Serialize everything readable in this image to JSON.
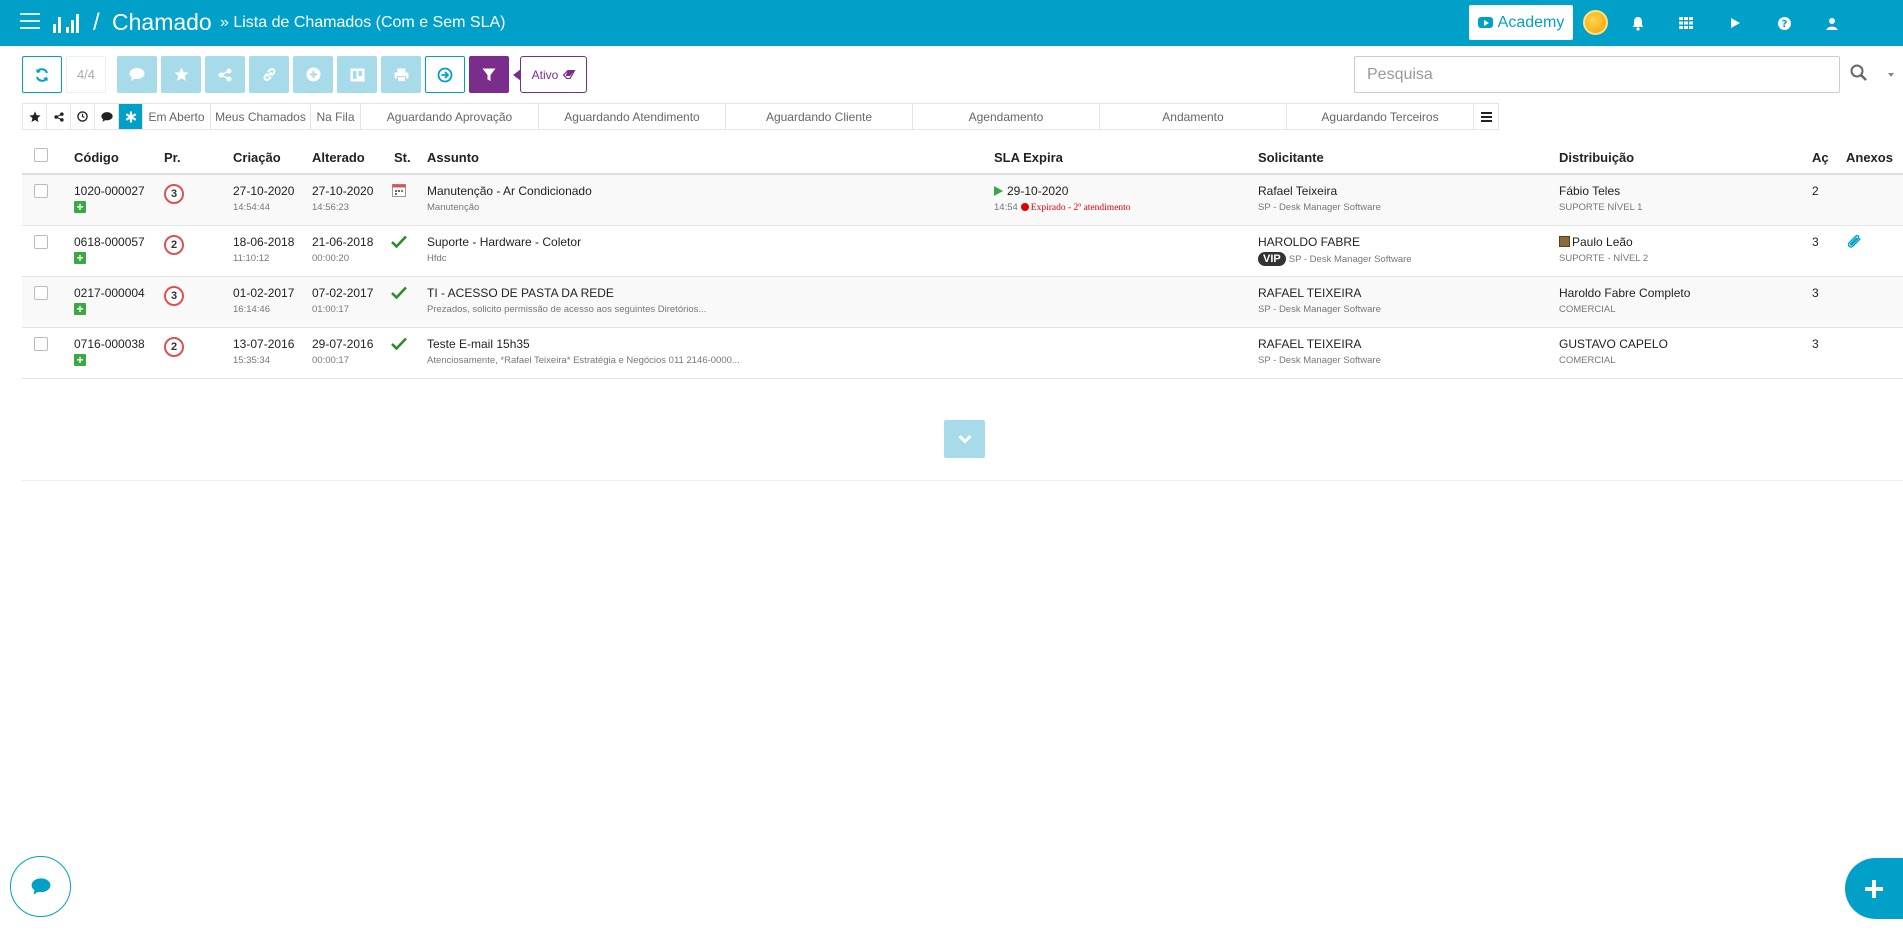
{
  "header": {
    "separator": "/",
    "module": "Chamado",
    "page_title": "» Lista de Chamados (Com e Sem SLA)",
    "academy_label": "Academy"
  },
  "colors": {
    "primary": "#00a0c8",
    "accent_purple": "#7b2d8b",
    "success": "#3aa845",
    "danger": "#e00000"
  },
  "toolbar": {
    "count": "4/4",
    "filter_status": "Ativo",
    "search_placeholder": "Pesquisa"
  },
  "tabs": [
    "Em Aberto",
    "Meus Chamados",
    "Na Fila",
    "Aguardando Aprovação",
    "Aguardando Atendimento",
    "Aguardando Cliente",
    "Agendamento",
    "Andamento",
    "Aguardando Terceiros"
  ],
  "table": {
    "columns": {
      "codigo": "Código",
      "prioridade": "Pr.",
      "criacao": "Criação",
      "alterado": "Alterado",
      "status": "St.",
      "assunto": "Assunto",
      "sla": "SLA Expira",
      "solicitante": "Solicitante",
      "distribuicao": "Distribuição",
      "acoes": "Aç",
      "anexos": "Anexos"
    },
    "rows": [
      {
        "codigo": "1020-000027",
        "prioridade": "3",
        "criacao_data": "27-10-2020",
        "criacao_hora": "14:54:44",
        "alterado_data": "27-10-2020",
        "alterado_hora": "14:56:23",
        "status_icon": "calendar-icon",
        "assunto": "Manutenção - Ar Condicionado",
        "assunto_sub": "Manutenção",
        "sla_data": "29-10-2020",
        "sla_hora": "14:54",
        "sla_status": "Expirado - 2º atendimento",
        "solicitante": "Rafael Teixeira",
        "vip": "",
        "solicitante_sub": "SP - Desk Manager Software",
        "distribuicao": "Fábio Teles",
        "distribuicao_sub": "SUPORTE NÍVEL 1",
        "acoes": "2",
        "anexo": false
      },
      {
        "codigo": "0618-000057",
        "prioridade": "2",
        "criacao_data": "18-06-2018",
        "criacao_hora": "11:10:12",
        "alterado_data": "21-06-2018",
        "alterado_hora": "00:00:20",
        "status_icon": "check-icon",
        "assunto": "Suporte - Hardware - Coletor",
        "assunto_sub": "Hfdc",
        "sla_data": "",
        "sla_hora": "",
        "sla_status": "",
        "solicitante": "HAROLDO FABRE",
        "vip": "VIP",
        "solicitante_sub": "SP - Desk Manager Software",
        "distribuicao": "Paulo Leão",
        "distribuicao_sub": "SUPORTE - NÍVEL 2",
        "acoes": "3",
        "anexo": true
      },
      {
        "codigo": "0217-000004",
        "prioridade": "3",
        "criacao_data": "01-02-2017",
        "criacao_hora": "16:14:46",
        "alterado_data": "07-02-2017",
        "alterado_hora": "01:00:17",
        "status_icon": "check-icon",
        "assunto": "TI - ACESSO DE PASTA DA REDE",
        "assunto_sub": "Prezados, solicito permissão de acesso aos seguintes Diretórios...",
        "sla_data": "",
        "sla_hora": "",
        "sla_status": "",
        "solicitante": "RAFAEL TEIXEIRA",
        "vip": "",
        "solicitante_sub": "SP - Desk Manager Software",
        "distribuicao": "Haroldo Fabre Completo",
        "distribuicao_sub": "COMERCIAL",
        "acoes": "3",
        "anexo": false
      },
      {
        "codigo": "0716-000038",
        "prioridade": "2",
        "criacao_data": "13-07-2016",
        "criacao_hora": "15:35:34",
        "alterado_data": "29-07-2016",
        "alterado_hora": "00:00:17",
        "status_icon": "check-icon",
        "assunto": "Teste E-mail 15h35",
        "assunto_sub": "Atenciosamente, *Rafael Teixeira* Estratégia e Negócios 011 2146-0000...",
        "sla_data": "",
        "sla_hora": "",
        "sla_status": "",
        "solicitante": "RAFAEL TEIXEIRA",
        "vip": "",
        "solicitante_sub": "SP - Desk Manager Software",
        "distribuicao": "GUSTAVO CAPELO",
        "distribuicao_sub": "COMERCIAL",
        "acoes": "3",
        "anexo": false
      }
    ]
  }
}
